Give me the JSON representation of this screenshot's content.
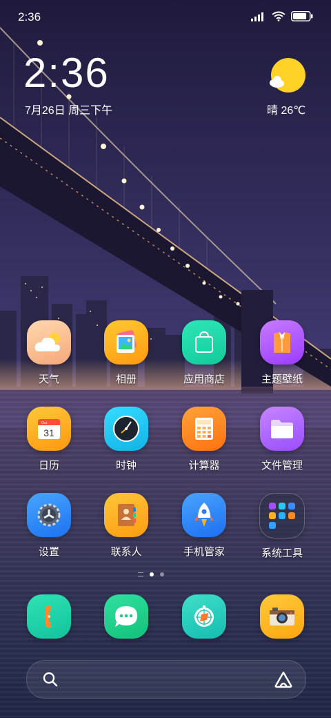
{
  "status_bar": {
    "time": "2:36",
    "icons": [
      "signal-icon",
      "wifi-icon",
      "battery-icon"
    ],
    "battery_level": 0.85
  },
  "clock_widget": {
    "time": "2:36",
    "date": "7月26日 周三下午"
  },
  "weather_widget": {
    "icon": "sunny-cloud-icon",
    "text": "晴 26℃"
  },
  "apps": [
    {
      "label": "天气",
      "icon": "weather-icon"
    },
    {
      "label": "相册",
      "icon": "gallery-icon"
    },
    {
      "label": "应用商店",
      "icon": "app-store-icon"
    },
    {
      "label": "主题壁纸",
      "icon": "themes-icon"
    },
    {
      "label": "日历",
      "icon": "calendar-icon",
      "icon_text": "31",
      "icon_subtext": "Oct"
    },
    {
      "label": "时钟",
      "icon": "clock-icon"
    },
    {
      "label": "计算器",
      "icon": "calculator-icon"
    },
    {
      "label": "文件管理",
      "icon": "file-manager-icon"
    },
    {
      "label": "设置",
      "icon": "settings-icon"
    },
    {
      "label": "联系人",
      "icon": "contacts-icon"
    },
    {
      "label": "手机管家",
      "icon": "security-icon"
    },
    {
      "label": "系统工具",
      "icon": "system-tools-folder-icon"
    }
  ],
  "page_indicator": {
    "pages": 2,
    "current": 1
  },
  "dock": [
    {
      "icon": "phone-icon"
    },
    {
      "icon": "messages-icon"
    },
    {
      "icon": "browser-icon"
    },
    {
      "icon": "camera-icon"
    }
  ],
  "search_bar": {
    "left_icon": "search-icon",
    "right_icon": "assistant-icon"
  },
  "colors": {
    "weather": "#f5b98a",
    "gallery": "#ffb21a",
    "app_store": "#1fd9a5",
    "themes": "#b15bff",
    "calendar": "#ffb020",
    "clock": "#1ec8f0",
    "calculator": "#ff8a1a",
    "file_manager": "#b56bff",
    "settings": "#2d8cff",
    "contacts": "#ffb51a",
    "security": "#2f8cff",
    "phone": "#20d6b4",
    "messages": "#22d48c",
    "browser": "#25cfc0",
    "camera": "#ffb51a"
  }
}
